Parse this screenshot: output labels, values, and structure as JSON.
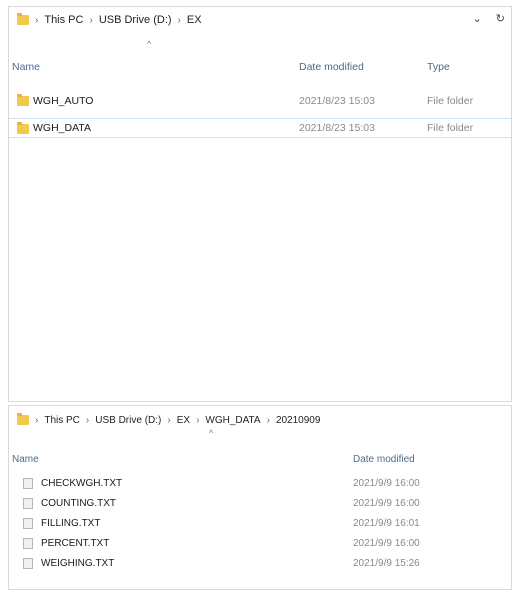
{
  "top": {
    "breadcrumb": [
      "This PC",
      "USB Drive (D:)",
      "EX"
    ],
    "columns": {
      "name": "Name",
      "date": "Date modified",
      "type": "Type"
    },
    "rows": [
      {
        "name": "WGH_AUTO",
        "date": "2021/8/23 15:03",
        "type": "File folder"
      },
      {
        "name": "WGH_DATA",
        "date": "2021/8/23 15:03",
        "type": "File folder"
      }
    ]
  },
  "bottom": {
    "breadcrumb": [
      "This PC",
      "USB Drive (D:)",
      "EX",
      "WGH_DATA",
      "20210909"
    ],
    "columns": {
      "name": "Name",
      "date": "Date modified"
    },
    "rows": [
      {
        "name": "CHECKWGH.TXT",
        "date": "2021/9/9 16:00"
      },
      {
        "name": "COUNTING.TXT",
        "date": "2021/9/9 16:00"
      },
      {
        "name": "FILLING.TXT",
        "date": "2021/9/9 16:01"
      },
      {
        "name": "PERCENT.TXT",
        "date": "2021/9/9 16:00"
      },
      {
        "name": "WEIGHING.TXT",
        "date": "2021/9/9 15:26"
      }
    ]
  },
  "icons": {
    "folder": "folder-icon",
    "file": "text-file-icon",
    "chevron": "chevron-down-icon",
    "refresh": "refresh-icon"
  }
}
